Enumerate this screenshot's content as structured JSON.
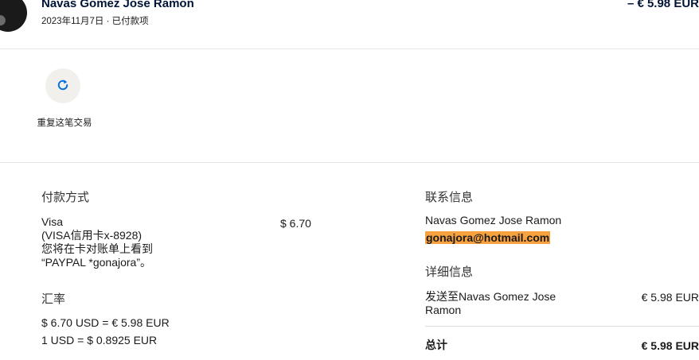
{
  "header": {
    "merchant_name": "Navas Gomez Jose Ramon",
    "subline": "2023年11月7日 · 已付款项",
    "amount": "– € 5.98 EUR"
  },
  "actions": {
    "repeat_label": "重复这笔交易"
  },
  "payment": {
    "section_title": "付款方式",
    "method": "Visa",
    "card": "(VISA信用卡x-8928)",
    "statement_line1": "您将在卡对账单上看到",
    "statement_line2": "“PAYPAL *gonajora”。",
    "amount": "$ 6.70"
  },
  "exchange": {
    "section_title": "汇率",
    "line1": "$ 6.70 USD = € 5.98 EUR",
    "line2": "1 USD = $ 0.8925 EUR"
  },
  "contact": {
    "section_title": "联系信息",
    "name": "Navas Gomez Jose Ramon",
    "email": "gonajora@hotmail.com"
  },
  "details": {
    "section_title": "详细信息",
    "item_line1": "发送至Navas Gomez Jose",
    "item_line2": "Ramon",
    "item_amount": "€ 5.98 EUR",
    "total_label": "总计",
    "total_amount": "€ 5.98 EUR"
  },
  "icons": {
    "avatar": "avatar-image",
    "repeat": "refresh-icon"
  },
  "colors": {
    "text_primary": "#001435",
    "email_highlight": "#f7a23f",
    "repeat_bg": "#f1f0ec",
    "repeat_icon": "#0070e0"
  }
}
